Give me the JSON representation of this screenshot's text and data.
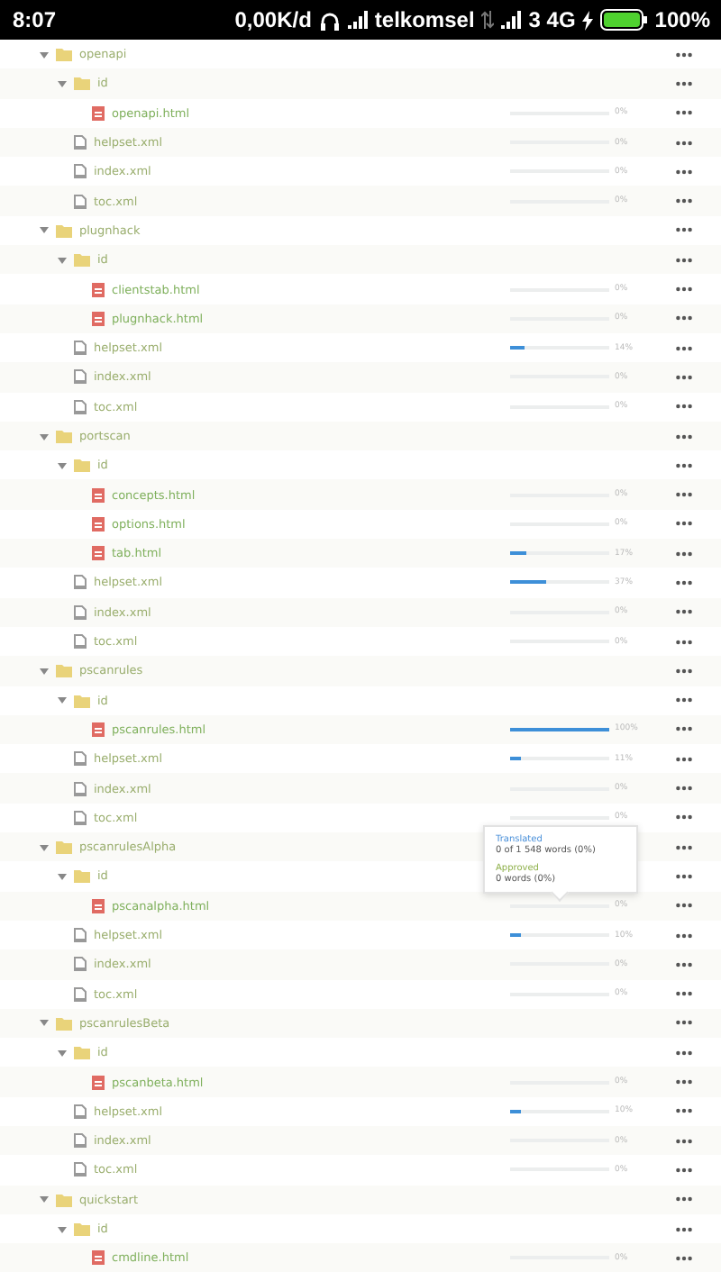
{
  "status_bar": {
    "time": "8:07",
    "speed": "0,00K/d",
    "carrier": "telkomsel",
    "network": "3 4G",
    "battery_text": "100%"
  },
  "tree": [
    {
      "kind": "folder",
      "name": "openapi",
      "expanded": true,
      "children": [
        {
          "kind": "folder",
          "name": "id",
          "expanded": true,
          "children": [
            {
              "kind": "html",
              "name": "openapi.html",
              "level": 0,
              "percent": "0%"
            }
          ]
        },
        {
          "kind": "xml",
          "name": "helpset.xml",
          "level": 0,
          "percent": "0%"
        },
        {
          "kind": "xml",
          "name": "index.xml",
          "level": 0,
          "percent": "0%"
        },
        {
          "kind": "xml",
          "name": "toc.xml",
          "level": 0,
          "percent": "0%"
        }
      ]
    },
    {
      "kind": "folder",
      "name": "plugnhack",
      "expanded": true,
      "children": [
        {
          "kind": "folder",
          "name": "id",
          "expanded": true,
          "children": [
            {
              "kind": "html",
              "name": "clientstab.html",
              "level": 0,
              "percent": "0%"
            },
            {
              "kind": "html",
              "name": "plugnhack.html",
              "level": 0,
              "percent": "0%"
            }
          ]
        },
        {
          "kind": "xml",
          "name": "helpset.xml",
          "level": 0.14,
          "percent": "14%"
        },
        {
          "kind": "xml",
          "name": "index.xml",
          "level": 0,
          "percent": "0%"
        },
        {
          "kind": "xml",
          "name": "toc.xml",
          "level": 0,
          "percent": "0%"
        }
      ]
    },
    {
      "kind": "folder",
      "name": "portscan",
      "expanded": true,
      "children": [
        {
          "kind": "folder",
          "name": "id",
          "expanded": true,
          "children": [
            {
              "kind": "html",
              "name": "concepts.html",
              "level": 0,
              "percent": "0%"
            },
            {
              "kind": "html",
              "name": "options.html",
              "level": 0,
              "percent": "0%"
            },
            {
              "kind": "html",
              "name": "tab.html",
              "level": 0.17,
              "percent": "17%"
            }
          ]
        },
        {
          "kind": "xml",
          "name": "helpset.xml",
          "level": 0.37,
          "percent": "37%"
        },
        {
          "kind": "xml",
          "name": "index.xml",
          "level": 0,
          "percent": "0%"
        },
        {
          "kind": "xml",
          "name": "toc.xml",
          "level": 0,
          "percent": "0%"
        }
      ]
    },
    {
      "kind": "folder",
      "name": "pscanrules",
      "expanded": true,
      "children": [
        {
          "kind": "folder",
          "name": "id",
          "expanded": true,
          "children": [
            {
              "kind": "html",
              "name": "pscanrules.html",
              "level": 1,
              "percent": "100%"
            }
          ]
        },
        {
          "kind": "xml",
          "name": "helpset.xml",
          "level": 0.11,
          "percent": "11%"
        },
        {
          "kind": "xml",
          "name": "index.xml",
          "level": 0,
          "percent": "0%"
        },
        {
          "kind": "xml",
          "name": "toc.xml",
          "level": 0,
          "percent": "0%"
        }
      ]
    },
    {
      "kind": "folder",
      "name": "pscanrulesAlpha",
      "expanded": true,
      "children": [
        {
          "kind": "folder",
          "name": "id",
          "expanded": true,
          "children": [
            {
              "kind": "html",
              "name": "pscanalpha.html",
              "level": 0,
              "percent": "0%"
            }
          ]
        },
        {
          "kind": "xml",
          "name": "helpset.xml",
          "level": 0.1,
          "percent": "10%"
        },
        {
          "kind": "xml",
          "name": "index.xml",
          "level": 0,
          "percent": "0%"
        },
        {
          "kind": "xml",
          "name": "toc.xml",
          "level": 0,
          "percent": "0%"
        }
      ]
    },
    {
      "kind": "folder",
      "name": "pscanrulesBeta",
      "expanded": true,
      "children": [
        {
          "kind": "folder",
          "name": "id",
          "expanded": true,
          "children": [
            {
              "kind": "html",
              "name": "pscanbeta.html",
              "level": 0,
              "percent": "0%"
            }
          ]
        },
        {
          "kind": "xml",
          "name": "helpset.xml",
          "level": 0.1,
          "percent": "10%"
        },
        {
          "kind": "xml",
          "name": "index.xml",
          "level": 0,
          "percent": "0%"
        },
        {
          "kind": "xml",
          "name": "toc.xml",
          "level": 0,
          "percent": "0%"
        }
      ]
    },
    {
      "kind": "folder",
      "name": "quickstart",
      "expanded": true,
      "children": [
        {
          "kind": "folder",
          "name": "id",
          "expanded": true,
          "children": [
            {
              "kind": "html",
              "name": "cmdline.html",
              "level": 0,
              "percent": "0%"
            }
          ]
        }
      ]
    }
  ],
  "tooltip": {
    "translated_label": "Translated",
    "translated_value": "0 of 1 548 words (0%)",
    "approved_label": "Approved",
    "approved_value": "0 words (0%)"
  }
}
